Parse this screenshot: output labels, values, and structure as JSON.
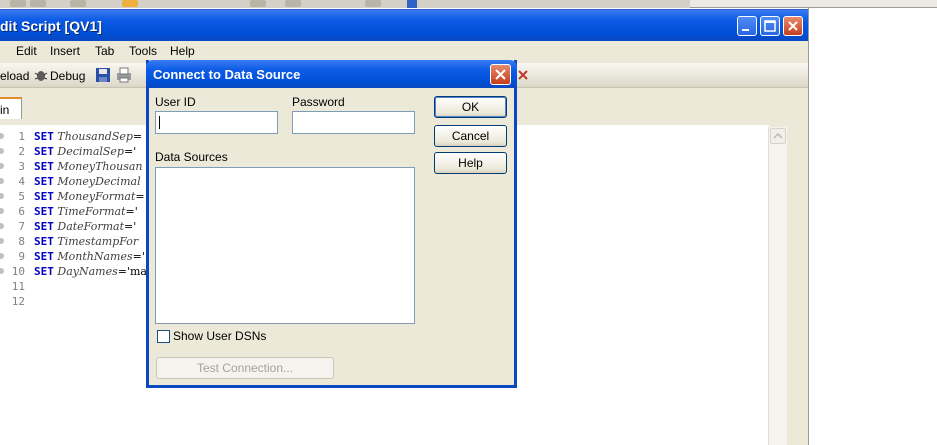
{
  "window": {
    "title": "dit Script [QV1]"
  },
  "menu": [
    "Edit",
    "Insert",
    "Tab",
    "Tools",
    "Help"
  ],
  "toolbar": {
    "reload_label": "eload",
    "debug_label": "Debug"
  },
  "tab": {
    "label": "in"
  },
  "editor": {
    "line_numbers": [
      "1",
      "2",
      "3",
      "4",
      "5",
      "6",
      "7",
      "8",
      "9",
      "10",
      "11",
      "12"
    ],
    "lines": [
      {
        "kw": "SET",
        "var": "ThousandSep",
        "rest": "="
      },
      {
        "kw": "SET",
        "var": "DecimalSep",
        "rest": "='"
      },
      {
        "kw": "SET",
        "var": "MoneyThousan",
        "rest": ""
      },
      {
        "kw": "SET",
        "var": "MoneyDecimal",
        "rest": ""
      },
      {
        "kw": "SET",
        "var": "MoneyFormat",
        "rest": "="
      },
      {
        "kw": "SET",
        "var": "TimeFormat",
        "rest": "='"
      },
      {
        "kw": "SET",
        "var": "DateFormat",
        "rest": "='"
      },
      {
        "kw": "SET",
        "var": "TimestampFor",
        "rest": ""
      },
      {
        "kw": "SET",
        "var": "MonthNames",
        "rest": "='"
      },
      {
        "kw": "SET",
        "var": "DayNames",
        "rest": "='ma"
      }
    ]
  },
  "dialog": {
    "title": "Connect to Data Source",
    "user_id_label": "User ID",
    "password_label": "Password",
    "data_sources_label": "Data Sources",
    "show_user_dsns_label": "Show User DSNs",
    "test_connection_label": "Test Connection...",
    "ok_label": "OK",
    "cancel_label": "Cancel",
    "help_label": "Help"
  }
}
